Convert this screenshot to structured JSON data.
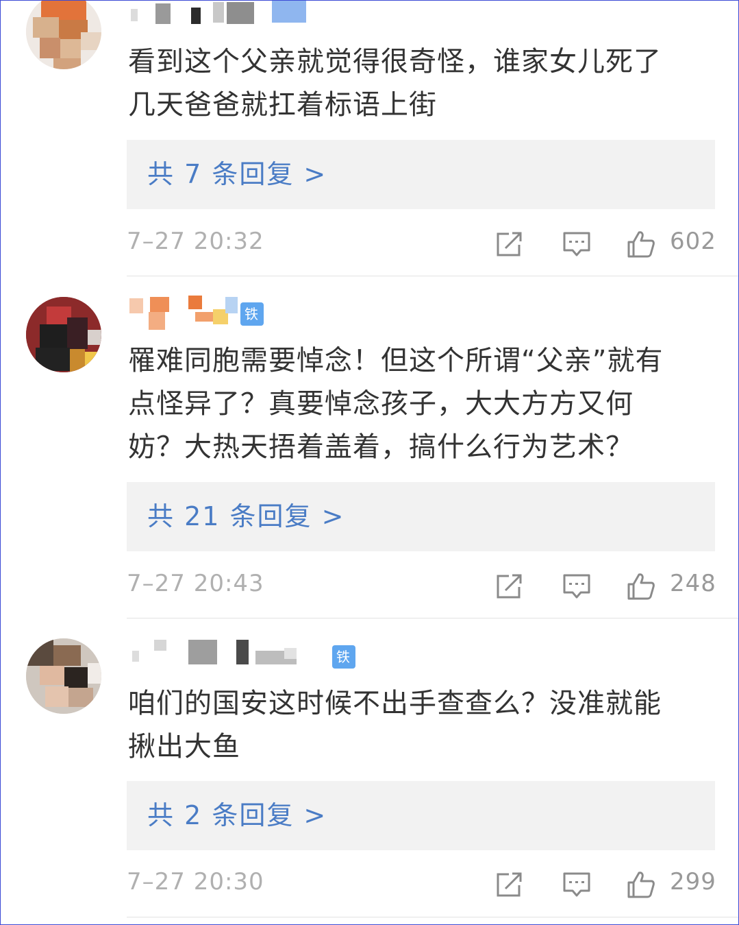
{
  "colors": {
    "accent": "#4a7cc5",
    "badge": "#5fa6ef",
    "text": "#333333",
    "muted": "#b0b0b0",
    "reply_bg": "#f2f2f2"
  },
  "comments": [
    {
      "username": "",
      "badge": "",
      "text_lines": [
        "看到这个父亲就觉得很奇怪，谁家女儿死了",
        "几天爸爸就扛着标语上街"
      ],
      "replies_label": "共 7 条回复 >",
      "time": "7–27 20:32",
      "likes": "602",
      "icons": [
        "share-icon",
        "comment-icon",
        "thumbs-up-icon"
      ]
    },
    {
      "username": "",
      "badge": "铁粉",
      "text_lines": [
        "罹难同胞需要悼念！但这个所谓“父亲”就有",
        "点怪异了？真要悼念孩子，大大方方又何",
        "妨？大热天捂着盖着，搞什么行为艺术？"
      ],
      "replies_label": "共 21 条回复 >",
      "time": "7–27 20:43",
      "likes": "248",
      "icons": [
        "share-icon",
        "comment-icon",
        "thumbs-up-icon"
      ]
    },
    {
      "username": "",
      "badge": "铁粉",
      "text_lines": [
        "咱们的国安这时候不出手查查么？没准就能",
        "揪出大鱼"
      ],
      "replies_label": "共 2 条回复 >",
      "time": "7–27 20:30",
      "likes": "299",
      "icons": [
        "share-icon",
        "comment-icon",
        "thumbs-up-icon"
      ]
    }
  ]
}
